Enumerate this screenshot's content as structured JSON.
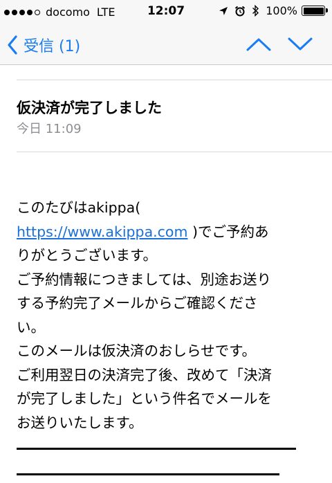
{
  "status_bar": {
    "carrier": "docomo",
    "network": "LTE",
    "time": "12:07",
    "battery": "100%",
    "battery_level": 1.0,
    "icons": [
      "location-arrow-icon",
      "alarm-clock-icon",
      "bluetooth-icon"
    ]
  },
  "nav": {
    "back_label": "受信 (1)",
    "icons": [
      "chevron-left-icon",
      "chevron-up-icon",
      "chevron-down-icon"
    ]
  },
  "message": {
    "subject": "仮決済が完了しました",
    "date": "今日 11:09",
    "body_lines": [
      {
        "pre": "このたびはakippa(",
        "link": "",
        "post": ""
      },
      {
        "pre": "",
        "link": "https://www.akippa.com",
        "post": " )でご予約あ"
      },
      {
        "pre": "りがとうございます。",
        "link": "",
        "post": ""
      },
      {
        "pre": "ご予約情報につきましては、別途お送り",
        "link": "",
        "post": ""
      },
      {
        "pre": "する予約完了メールからご確認くださ",
        "link": "",
        "post": ""
      },
      {
        "pre": "い。",
        "link": "",
        "post": ""
      },
      {
        "pre": "このメールは仮決済のおしらせです。",
        "link": "",
        "post": ""
      },
      {
        "pre": "ご利用翌日の決済完了後、改めて「決済",
        "link": "",
        "post": ""
      },
      {
        "pre": "が完了しました」という件名でメールを",
        "link": "",
        "post": ""
      },
      {
        "pre": "お送りいたします。",
        "link": "",
        "post": ""
      }
    ]
  },
  "colors": {
    "accent": "#1a7cf3",
    "link": "#1a6fd8",
    "secondary_text": "#8e8e93",
    "bar_background": "#f7f7f7"
  }
}
